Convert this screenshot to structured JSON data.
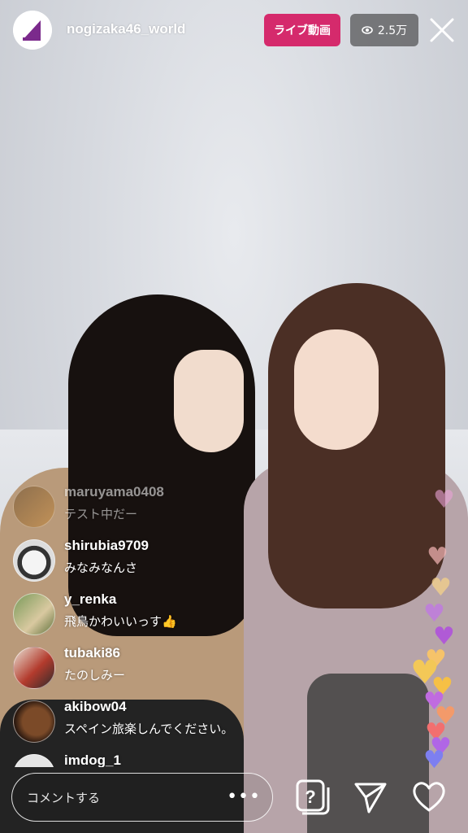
{
  "header": {
    "username": "nogizaka46_world",
    "live_label": "ライブ動画",
    "viewer_count": "2.5万"
  },
  "comments": [
    {
      "user": "maruyama0408",
      "text": "テスト中だー"
    },
    {
      "user": "shirubia9709",
      "text": "みなみなんさ"
    },
    {
      "user": "y_renka",
      "text": "飛鳥かわいいっす👍"
    },
    {
      "user": "tubaki86",
      "text": "たのしみー"
    },
    {
      "user": "akibow04",
      "text": "スペイン旅楽しんでください。"
    },
    {
      "user": "imdog_1",
      "text": ""
    }
  ],
  "footer": {
    "comment_placeholder": "コメントする",
    "more_label": "•••"
  },
  "colors": {
    "live_badge": "#d52a6c",
    "viewer_badge": "#505052",
    "logo_purple": "#7b2a8c"
  },
  "icons": [
    "eye-icon",
    "close-icon",
    "more-icon",
    "question-box-icon",
    "send-icon",
    "heart-icon"
  ]
}
